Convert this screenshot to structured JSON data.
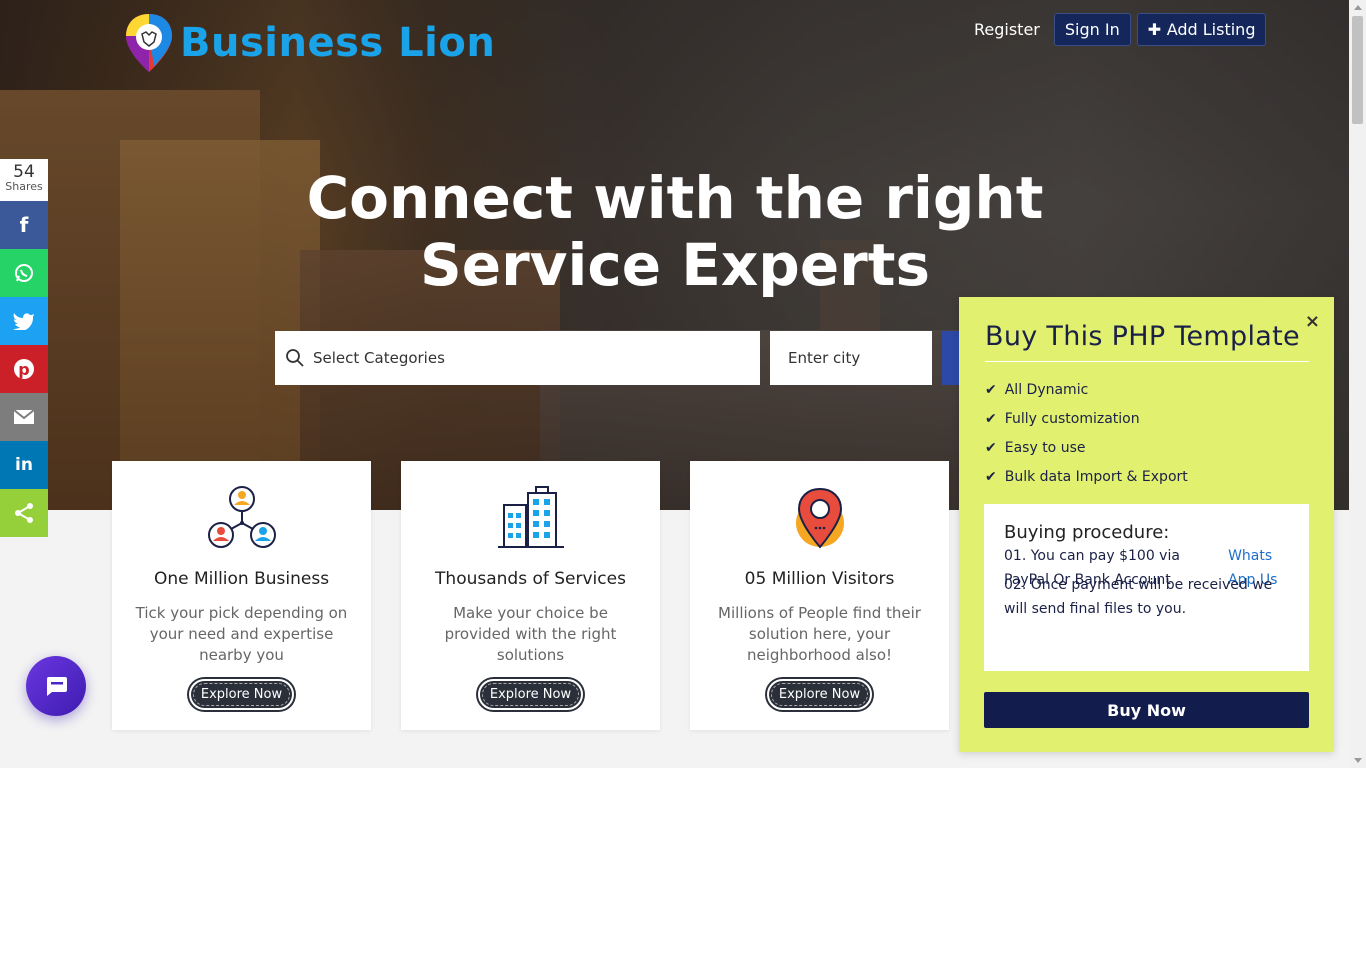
{
  "brand": {
    "name": "Business Lion"
  },
  "nav": {
    "register": "Register",
    "sign_in": "Sign In",
    "add_listing": "Add Listing"
  },
  "hero": {
    "line1": "Connect with the right",
    "line2": "Service Experts"
  },
  "search": {
    "category_placeholder": "Select Categories",
    "city_placeholder": "Enter city"
  },
  "share": {
    "count": "54",
    "count_label": "Shares",
    "items": [
      {
        "name": "facebook",
        "color": "#3b5998"
      },
      {
        "name": "whatsapp",
        "color": "#25d366"
      },
      {
        "name": "twitter",
        "color": "#1da1f2"
      },
      {
        "name": "pinterest",
        "color": "#cb2027"
      },
      {
        "name": "email",
        "color": "#7d7d7d"
      },
      {
        "name": "linkedin",
        "color": "#0077b5"
      },
      {
        "name": "share",
        "color": "#95d03a"
      }
    ]
  },
  "cards": [
    {
      "title": "One Million Business",
      "desc": "Tick your pick depending on your need and expertise nearby you",
      "button": "Explore Now",
      "icon": "network-people-icon"
    },
    {
      "title": "Thousands of Services",
      "desc": "Make your choice be provided with the right solutions",
      "button": "Explore Now",
      "icon": "buildings-icon"
    },
    {
      "title": "05 Million Visitors",
      "desc": "Millions of People find their solution here, your neighborhood also!",
      "button": "Explore Now",
      "icon": "map-pin-icon"
    }
  ],
  "popup": {
    "title": "Buy This PHP Template",
    "close": "×",
    "features": [
      "All Dynamic",
      "Fully customization",
      "Easy to use",
      "Bulk data Import & Export"
    ],
    "procedure_title": "Buying procedure:",
    "step1_text": "01. You can pay $100 via PayPal Or Bank Account",
    "step1_link": "Whats App Us",
    "step2_text": "02. Once payment will be received we will send final files to you.",
    "buy_button": "Buy Now"
  },
  "colors": {
    "accent": "#1aa3e8",
    "navy": "#121d4d",
    "popup_bg": "#e2f070",
    "chat": "#5a2fd6"
  }
}
